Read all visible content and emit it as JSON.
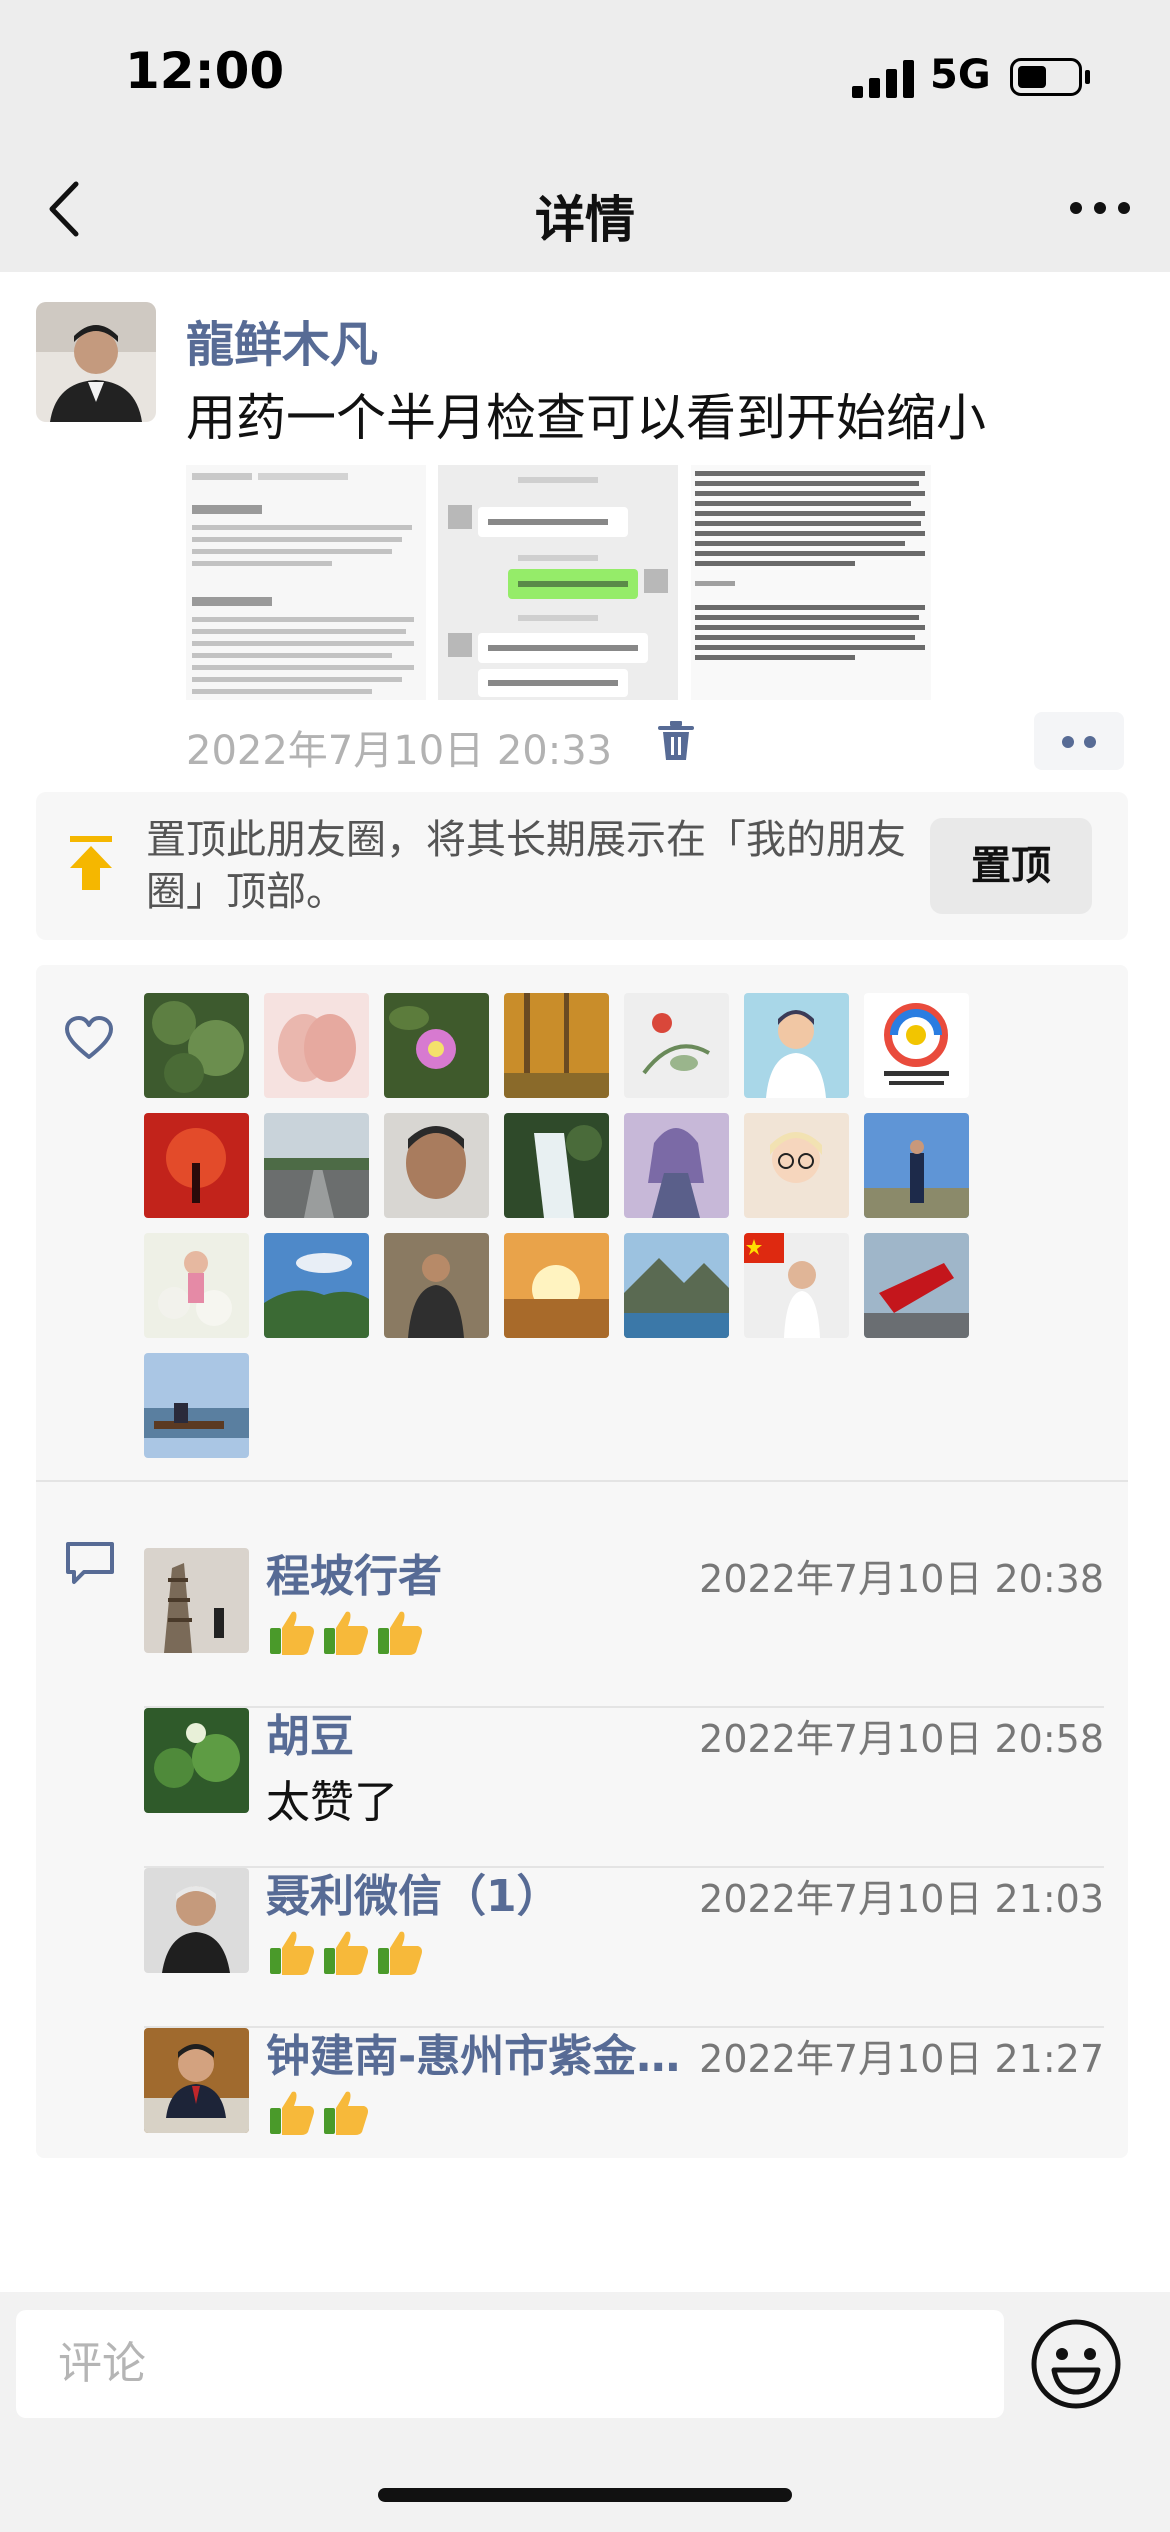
{
  "status_bar": {
    "time": "12:00",
    "network": "5G"
  },
  "nav": {
    "title": "详情"
  },
  "post": {
    "author": "龍鲜木凡",
    "text": "用药一个半月检查可以看到开始缩小",
    "time": "2022年7月10日 20:33"
  },
  "pin": {
    "text": "置顶此朋友圈，将其长期展示在「我的朋友圈」顶部。",
    "button": "置顶"
  },
  "likes": {
    "count": 22
  },
  "comments": [
    {
      "name": "程坡行者",
      "time": "2022年7月10日 20:38",
      "text": "",
      "thumbs": 3
    },
    {
      "name": "胡豆",
      "time": "2022年7月10日 20:58",
      "text": "太赞了",
      "thumbs": 0
    },
    {
      "name": "聂利微信（1）",
      "time": "2022年7月10日 21:03",
      "text": "",
      "thumbs": 3
    },
    {
      "name": "钟建南-惠州市紫金…",
      "time": "2022年7月10日 21:27",
      "text": "",
      "thumbs": 2
    }
  ],
  "input": {
    "placeholder": "评论"
  },
  "colors": {
    "link": "#576b95",
    "background": "#ededed",
    "panel": "#f7f7f7"
  },
  "icons": [
    "back-icon",
    "more-icon",
    "trash-icon",
    "pin-icon",
    "heart-icon",
    "comment-icon",
    "thumbs-up-icon",
    "emoji-icon"
  ]
}
